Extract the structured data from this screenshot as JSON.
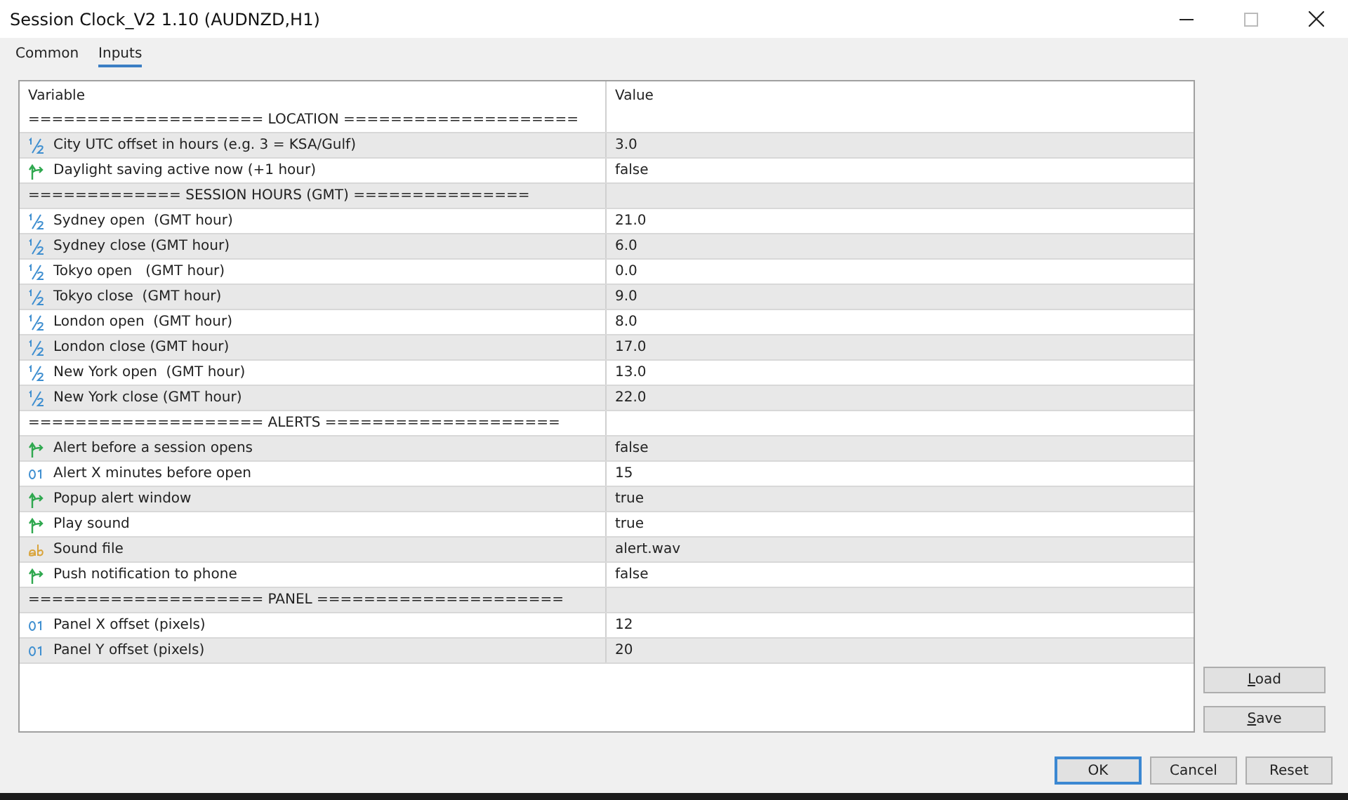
{
  "window": {
    "title": "Session Clock_V2 1.10 (AUDNZD,H1)"
  },
  "tabs": [
    {
      "label": "Common",
      "selected": false
    },
    {
      "label": "Inputs",
      "selected": true
    }
  ],
  "table": {
    "columns": [
      "Variable",
      "Value"
    ],
    "rows": [
      {
        "kind": "separator",
        "variable": "==================== LOCATION ===================="
      },
      {
        "kind": "double",
        "variable": "City UTC offset in hours (e.g. 3 = KSA/Gulf)",
        "value": "3.0"
      },
      {
        "kind": "bool",
        "variable": "Daylight saving active now (+1 hour)",
        "value": "false"
      },
      {
        "kind": "separator",
        "variable": "============= SESSION HOURS (GMT) ==============="
      },
      {
        "kind": "double",
        "variable": "Sydney open  (GMT hour)",
        "value": "21.0"
      },
      {
        "kind": "double",
        "variable": "Sydney close (GMT hour)",
        "value": "6.0"
      },
      {
        "kind": "double",
        "variable": "Tokyo open   (GMT hour)",
        "value": "0.0"
      },
      {
        "kind": "double",
        "variable": "Tokyo close  (GMT hour)",
        "value": "9.0"
      },
      {
        "kind": "double",
        "variable": "London open  (GMT hour)",
        "value": "8.0"
      },
      {
        "kind": "double",
        "variable": "London close (GMT hour)",
        "value": "17.0"
      },
      {
        "kind": "double",
        "variable": "New York open  (GMT hour)",
        "value": "13.0"
      },
      {
        "kind": "double",
        "variable": "New York close (GMT hour)",
        "value": "22.0"
      },
      {
        "kind": "separator",
        "variable": "==================== ALERTS ===================="
      },
      {
        "kind": "bool",
        "variable": "Alert before a session opens",
        "value": "false"
      },
      {
        "kind": "int",
        "variable": "Alert X minutes before open",
        "value": "15"
      },
      {
        "kind": "bool",
        "variable": "Popup alert window",
        "value": "true"
      },
      {
        "kind": "bool",
        "variable": "Play sound",
        "value": "true"
      },
      {
        "kind": "string",
        "variable": "Sound file",
        "value": "alert.wav"
      },
      {
        "kind": "bool",
        "variable": "Push notification to phone",
        "value": "false"
      },
      {
        "kind": "separator",
        "variable": "==================== PANEL ====================="
      },
      {
        "kind": "int",
        "variable": "Panel X offset (pixels)",
        "value": "12"
      },
      {
        "kind": "int",
        "variable": "Panel Y offset (pixels)",
        "value": "20"
      }
    ]
  },
  "side_buttons": [
    {
      "label": "Load",
      "first_letter_underlined": true
    },
    {
      "label": "Save",
      "first_letter_underlined": true
    }
  ],
  "buttons": [
    {
      "label": "OK",
      "selected": true
    },
    {
      "label": "Cancel",
      "selected": false
    },
    {
      "label": "Reset",
      "selected": false
    }
  ]
}
